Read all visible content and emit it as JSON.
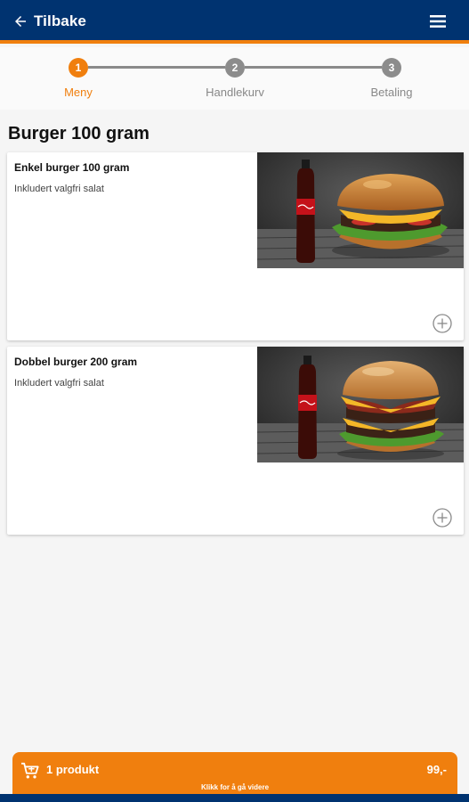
{
  "header": {
    "back_label": "Tilbake",
    "back_icon": "arrow-left-icon",
    "menu_icon": "hamburger-menu-icon",
    "bg_color": "#003370",
    "accent_color": "#f07f0e"
  },
  "steps": [
    {
      "number": "1",
      "label": "Meny",
      "active": true
    },
    {
      "number": "2",
      "label": "Handlekurv",
      "active": false
    },
    {
      "number": "3",
      "label": "Betaling",
      "active": false
    }
  ],
  "section": {
    "title": "Burger 100 gram"
  },
  "products": [
    {
      "name": "Enkel burger 100 gram",
      "description": "Inkludert valgfri salat",
      "image": "burger-with-cola-photo",
      "add_icon": "plus-circle-icon"
    },
    {
      "name": "Dobbel burger 200 gram",
      "description": "Inkludert valgfri salat",
      "image": "double-burger-with-cola-photo",
      "add_icon": "plus-circle-icon"
    }
  ],
  "cart": {
    "icon": "cart-icon",
    "count_label": "1 produkt",
    "price": "99,-",
    "hint": "Klikk for å gå videre"
  }
}
